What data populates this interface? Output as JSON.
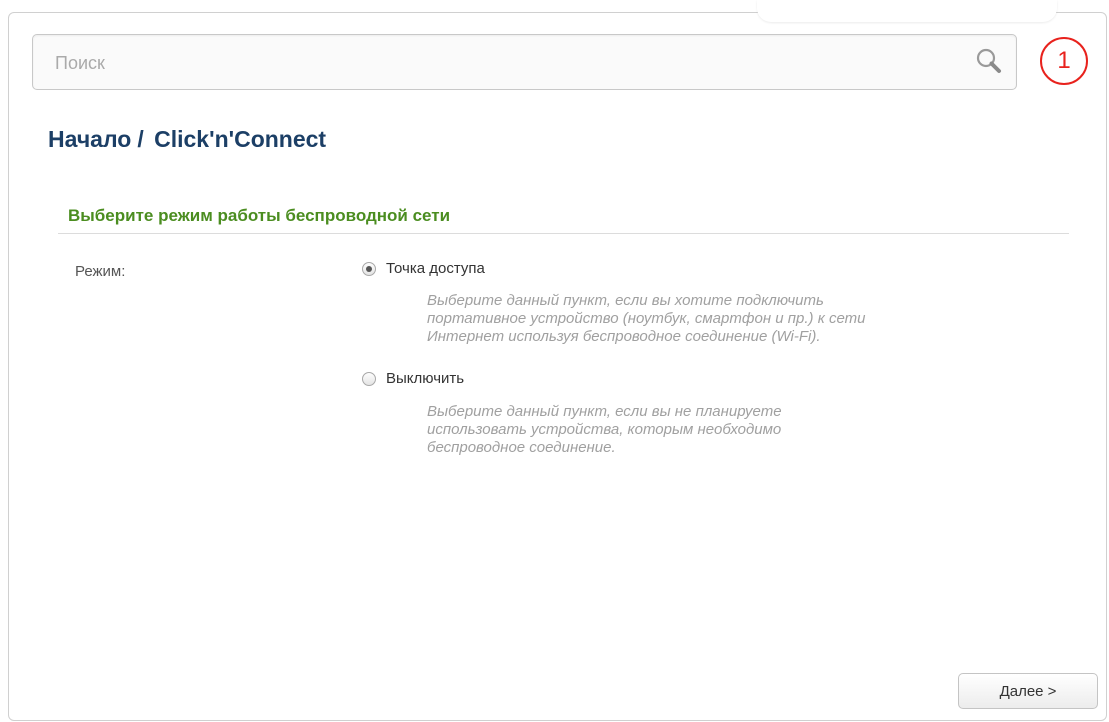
{
  "search": {
    "placeholder": "Поиск",
    "icon": "search-icon"
  },
  "step_indicator": {
    "number": "1",
    "color": "#e8221d"
  },
  "breadcrumb": {
    "home": "Начало",
    "separator": "/",
    "current": "Click'n'Connect"
  },
  "section": {
    "title": "Выберите режим работы беспроводной сети"
  },
  "mode": {
    "label": "Режим:",
    "selected": "access_point",
    "options": [
      {
        "label": "Точка доступа",
        "checked": true,
        "hint": [
          "Выберите данный пункт, если вы хотите подключить",
          "портативное устройство (ноутбук, смартфон и пр.) к сети",
          "Интернет используя беспроводное соединение (Wi-Fi)."
        ]
      },
      {
        "label": "Выключить",
        "checked": false,
        "hint": [
          "Выберите данный пункт, если вы не планируете",
          "использовать устройства, которым необходимо",
          "беспроводное соединение."
        ]
      }
    ]
  },
  "footer": {
    "next_label": "Далее >"
  },
  "colors": {
    "title": "#1c3f66",
    "section_title": "#4b8d20",
    "hint": "#a0a0a0"
  }
}
